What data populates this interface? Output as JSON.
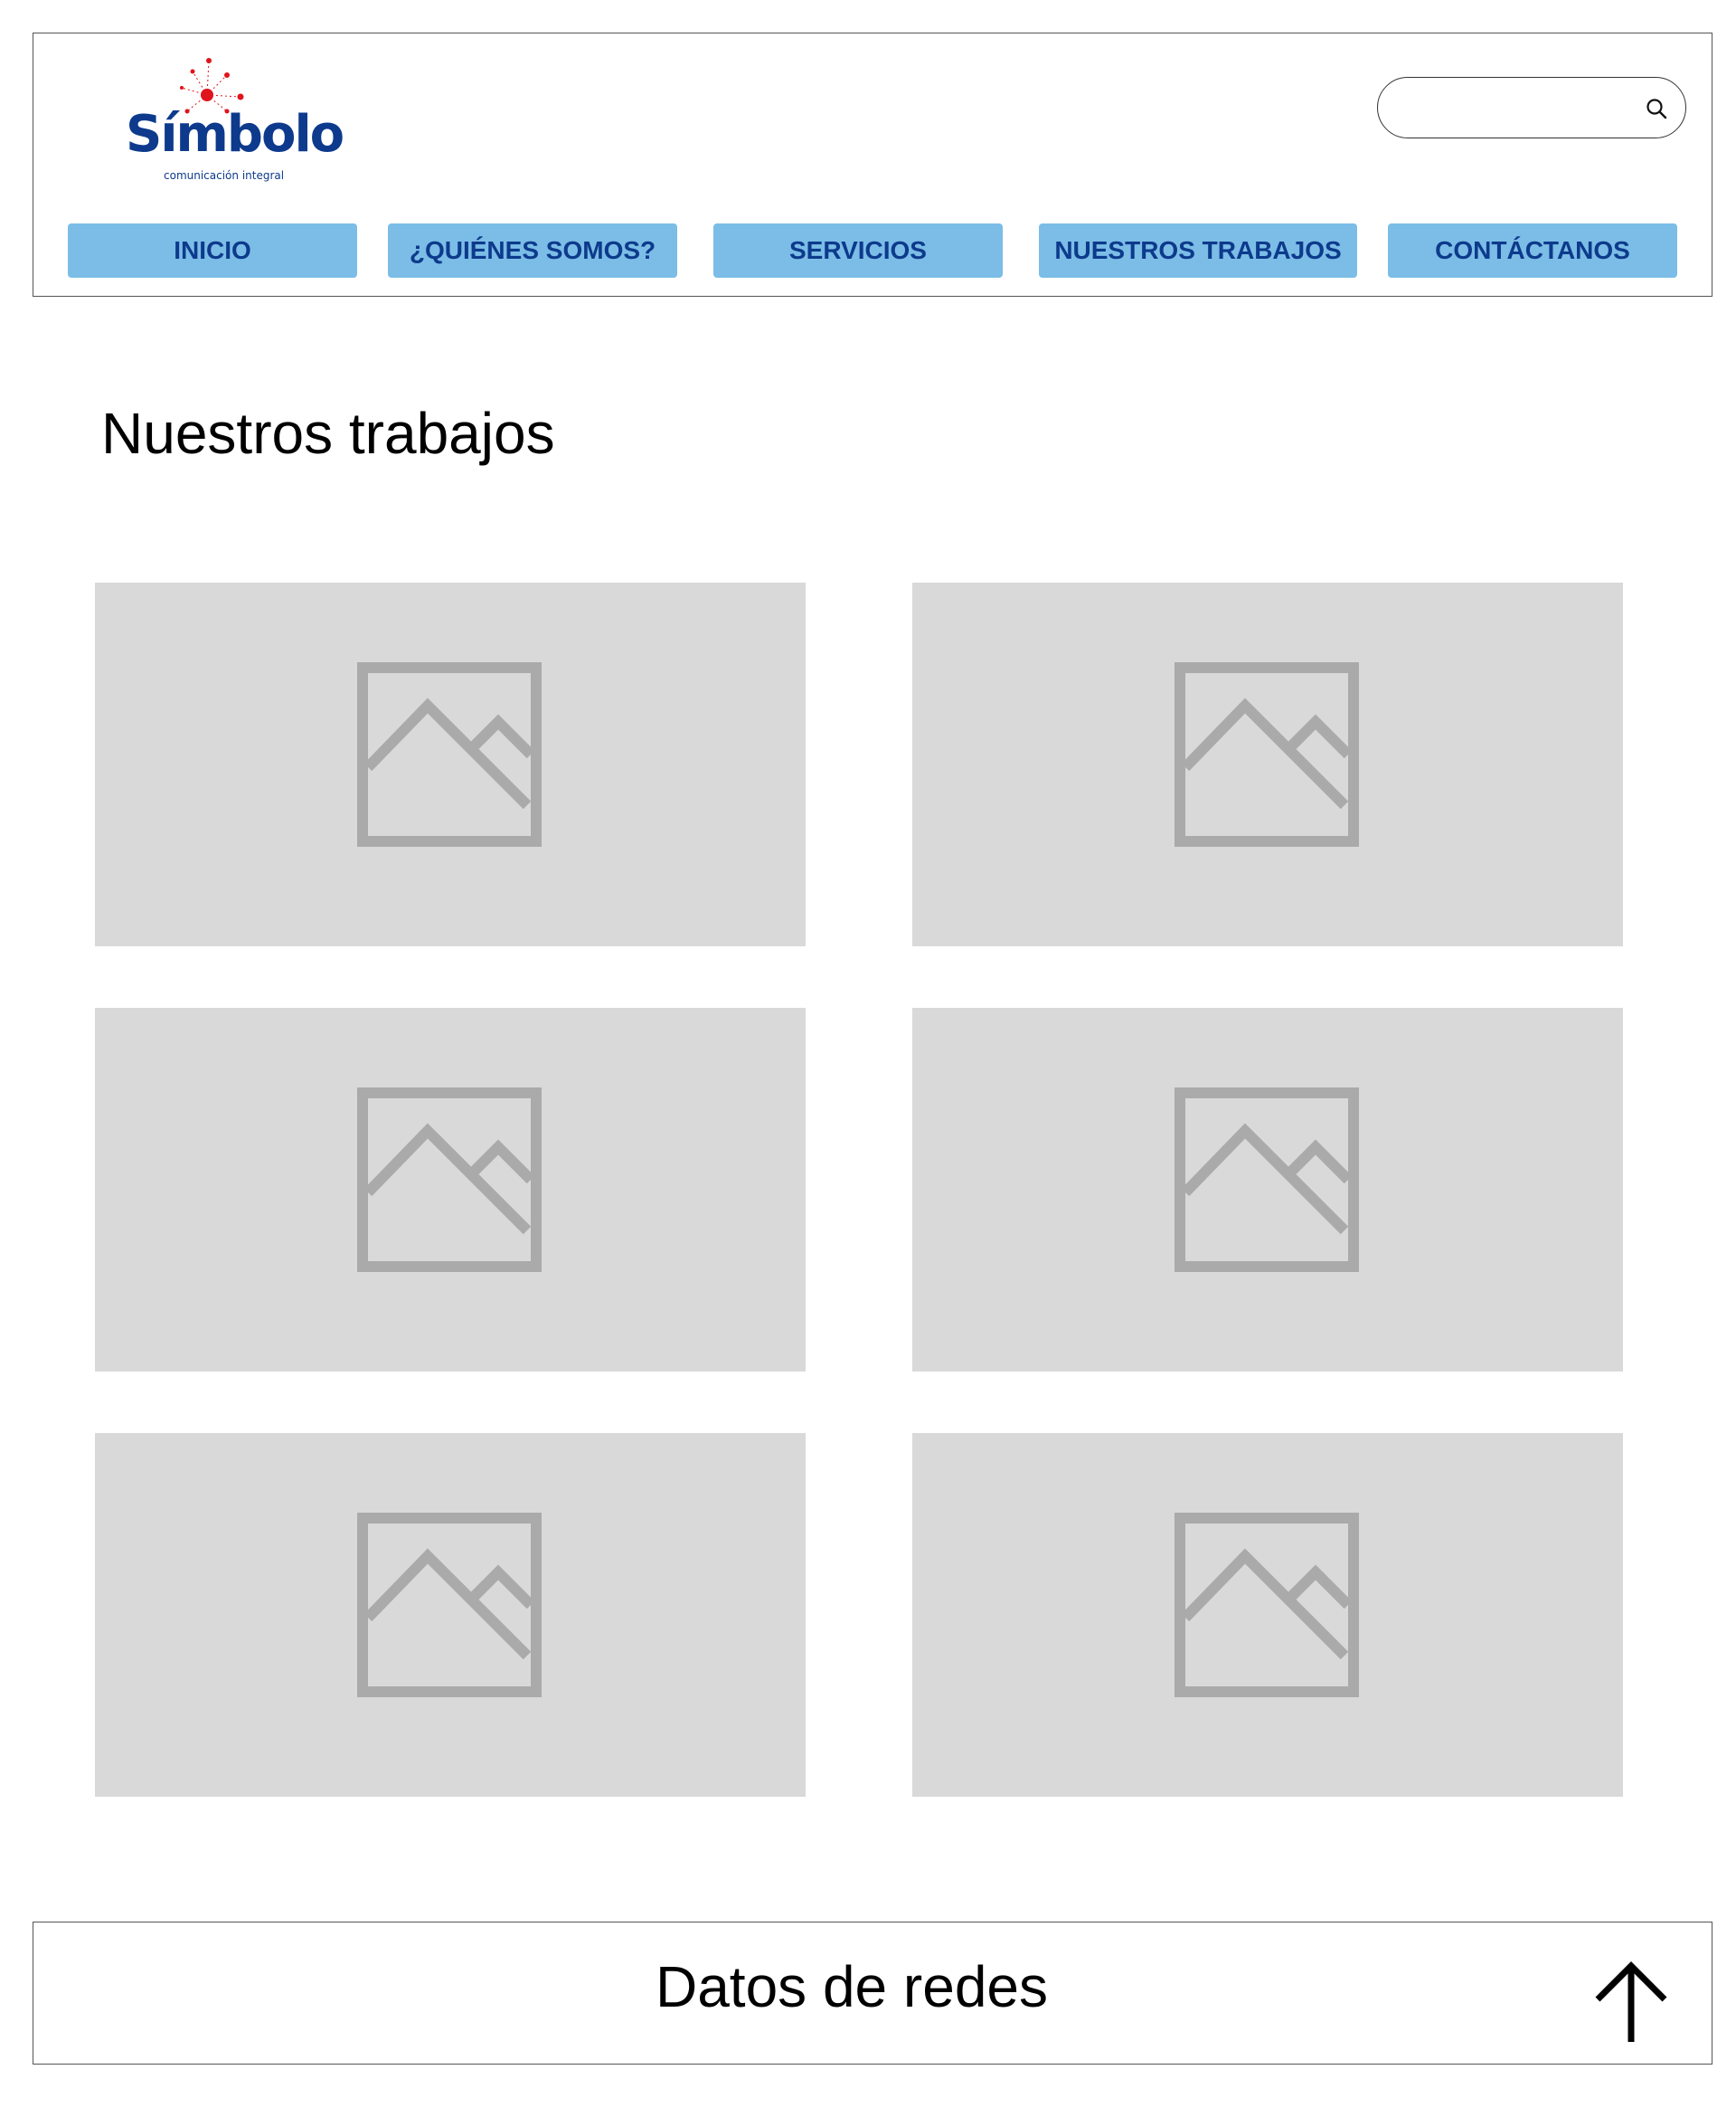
{
  "brand": {
    "name": "Símbolo",
    "tagline": "comunicación integral",
    "logo_color": "#0d3a8c",
    "accent_color": "#e0141c"
  },
  "search": {
    "placeholder": "",
    "value": "",
    "icon": "search-icon"
  },
  "nav": {
    "button_color": "#7bbde6",
    "text_color": "#0d3a8c",
    "items": [
      {
        "label": "INICIO"
      },
      {
        "label": "¿QUIÉNES SOMOS?"
      },
      {
        "label": "SERVICIOS"
      },
      {
        "label": "NUESTROS TRABAJOS"
      },
      {
        "label": "CONTÁCTANOS"
      }
    ]
  },
  "main": {
    "title": "Nuestros trabajos",
    "gallery": {
      "tile_count": 6,
      "tile_icon": "image-placeholder-icon",
      "tile_color": "#d9d9d9",
      "icon_color": "#aaaaaa"
    }
  },
  "footer": {
    "text": "Datos de redes",
    "back_to_top_icon": "arrow-up-icon"
  }
}
